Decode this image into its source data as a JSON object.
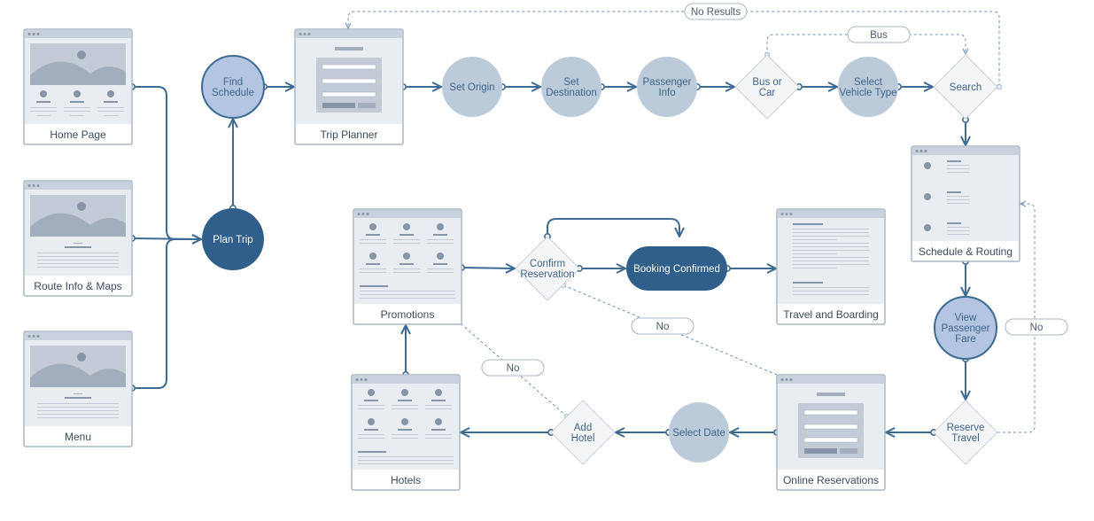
{
  "colors": {
    "edge": "#3d6b94",
    "node_light": "#bccbd9",
    "node_highlight": "#b4c5e4",
    "node_dark": "#2f5f8a",
    "card_border": "#a9b7c6"
  },
  "screens": {
    "home": "Home Page",
    "route": "Route Info & Maps",
    "menu": "Menu",
    "trip_planner": "Trip Planner",
    "schedule": "Schedule & Routing",
    "promotions": "Promotions",
    "travel": "Travel and Boarding",
    "hotels": "Hotels",
    "online": "Online Reservations"
  },
  "steps": {
    "find_schedule": [
      "Find",
      "Schedule"
    ],
    "plan_trip": "Plan Trip",
    "set_origin": "Set Origin",
    "set_destination": [
      "Set",
      "Destination"
    ],
    "passenger_info": [
      "Passenger",
      "Info"
    ],
    "select_vehicle": [
      "Select",
      "Vehicle Type"
    ],
    "view_fare": [
      "View",
      "Passenger",
      "Fare"
    ],
    "select_date": "Select Date",
    "booking_confirmed": "Booking Confirmed"
  },
  "decisions": {
    "bus_or_car": [
      "Bus or",
      "Car"
    ],
    "search": "Search",
    "reserve_travel": [
      "Reserve",
      "Travel"
    ],
    "add_hotel": [
      "Add",
      "Hotel"
    ],
    "confirm_reservation": [
      "Confirm",
      "Reservation"
    ]
  },
  "edge_labels": {
    "no_results": "No Results",
    "bus": "Bus",
    "no_confirm": "No",
    "no_hotel": "No",
    "no_reserve": "No"
  }
}
